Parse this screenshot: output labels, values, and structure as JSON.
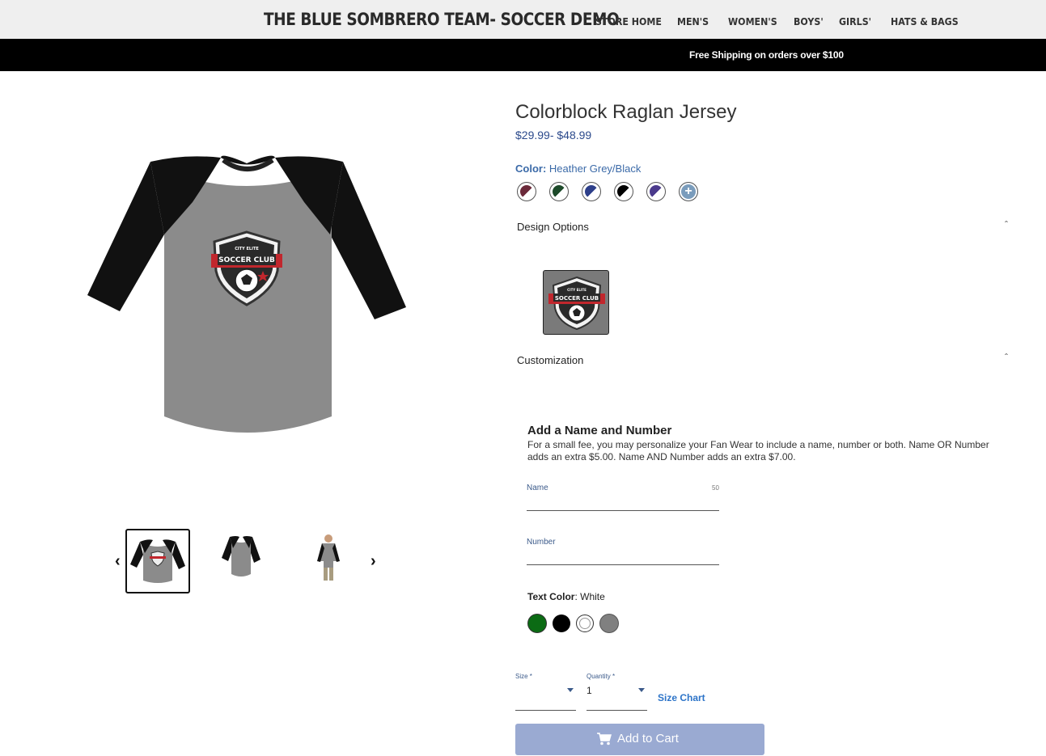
{
  "header": {
    "brand": "THE BLUE SOMBRERO TEAM- SOCCER DEMO",
    "nav": [
      "STORE HOME",
      "MEN'S",
      "WOMEN'S",
      "BOYS'",
      "GIRLS'",
      "HATS & BAGS"
    ]
  },
  "promo": {
    "text": "Free Shipping on orders over $100"
  },
  "gallery": {
    "badge_text": {
      "line1": "CITY ELITE",
      "line2": "SOCCER CLUB"
    }
  },
  "product": {
    "title": "Colorblock Raglan Jersey",
    "price": "$29.99- $48.99",
    "color_label": "Color:",
    "color_value": " Heather Grey/Black",
    "swatches": [
      {
        "name": "Maroon/White",
        "color": "#6b2a3a"
      },
      {
        "name": "Forest Green/White",
        "color": "#1d4a2a"
      },
      {
        "name": "Royal/White",
        "color": "#2d3f8a"
      },
      {
        "name": "Black/White",
        "color": "#000000"
      },
      {
        "name": "Purple/White",
        "color": "#4b3a8c"
      }
    ],
    "more_colors_icon": "plus-icon"
  },
  "design_options": {
    "heading": "Design Options"
  },
  "customization": {
    "heading": "Customization",
    "add_heading": "Add a Name and Number",
    "add_text": "For a small fee, you may personalize your Fan Wear to include a name, number or both. Name OR Number adds an extra $5.00. Name AND Number adds an extra $7.00.",
    "name_label": "Name",
    "name_max": "50",
    "number_label": "Number",
    "text_color_label": "Text Color",
    "text_color_value": ": White",
    "text_colors": [
      {
        "name": "Green",
        "color": "#0b6b14"
      },
      {
        "name": "Black",
        "color": "#000000"
      },
      {
        "name": "White",
        "color": "#ffffff"
      },
      {
        "name": "Grey",
        "color": "#808080"
      }
    ]
  },
  "purchase": {
    "size_label": "Size *",
    "qty_label": "Quantity *",
    "qty_value": "1",
    "size_chart": "Size Chart",
    "add_to_cart": "Add to Cart"
  }
}
